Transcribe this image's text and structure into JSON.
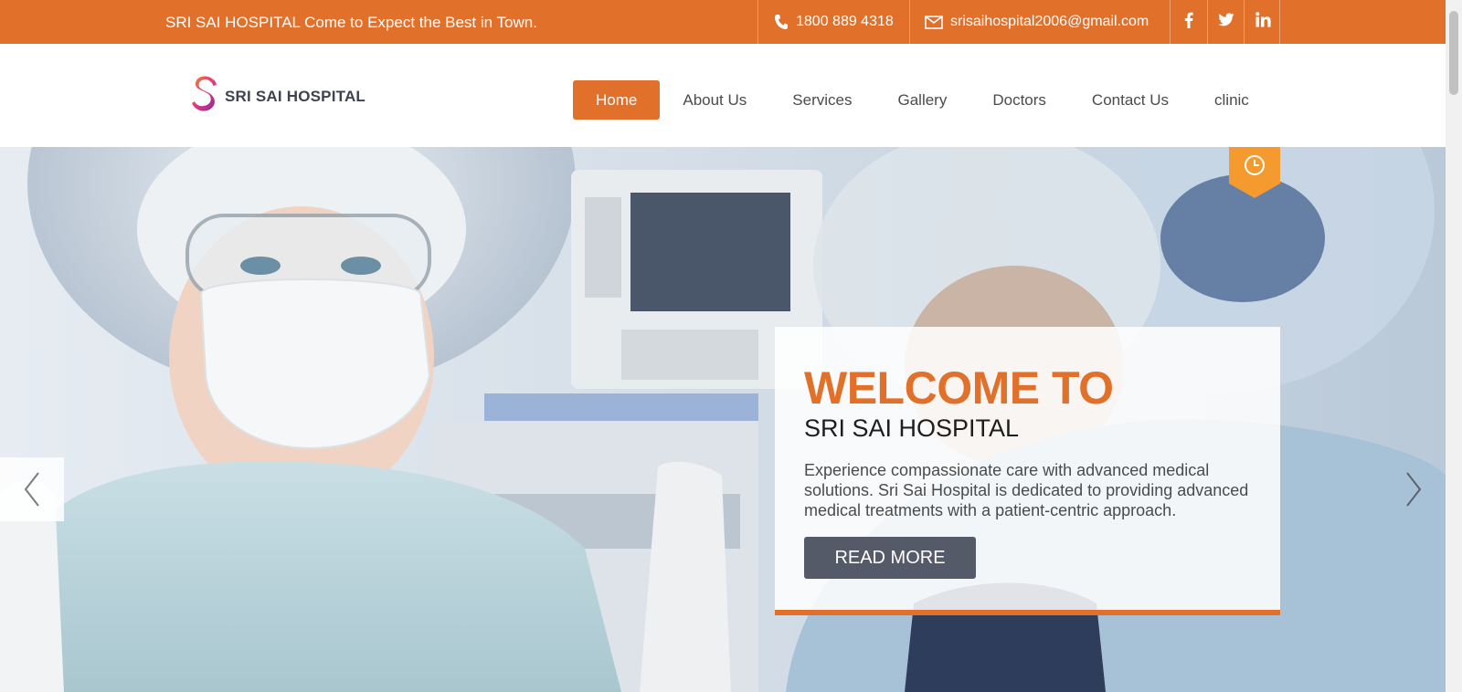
{
  "topbar": {
    "tagline": "SRI SAI HOSPITAL Come to Expect the Best in Town.",
    "phone": "1800 889 4318",
    "email": "srisaihospital2006@gmail.com",
    "social": [
      "facebook-icon",
      "twitter-icon",
      "linkedin-icon"
    ],
    "background": "#e1702b"
  },
  "header": {
    "logo_text": "SRI SAI HOSPITAL",
    "nav": [
      {
        "label": "Home",
        "active": true
      },
      {
        "label": "About Us",
        "active": false
      },
      {
        "label": "Services",
        "active": false
      },
      {
        "label": "Gallery",
        "active": false
      },
      {
        "label": "Doctors",
        "active": false
      },
      {
        "label": "Contact Us",
        "active": false
      },
      {
        "label": "clinic",
        "active": false
      }
    ]
  },
  "hero": {
    "title": "WELCOME TO",
    "subtitle": "SRI SAI HOSPITAL",
    "text": "Experience compassionate care with advanced medical solutions. Sri Sai Hospital is dedicated to providing advanced medical treatments with a patient-centric approach.",
    "button_label": "READ MORE",
    "accent_color": "#e1702b",
    "button_color": "#555a68"
  },
  "icons": {
    "clock": "clock-icon",
    "prev": "chevron-left-icon",
    "next": "chevron-right-icon"
  }
}
